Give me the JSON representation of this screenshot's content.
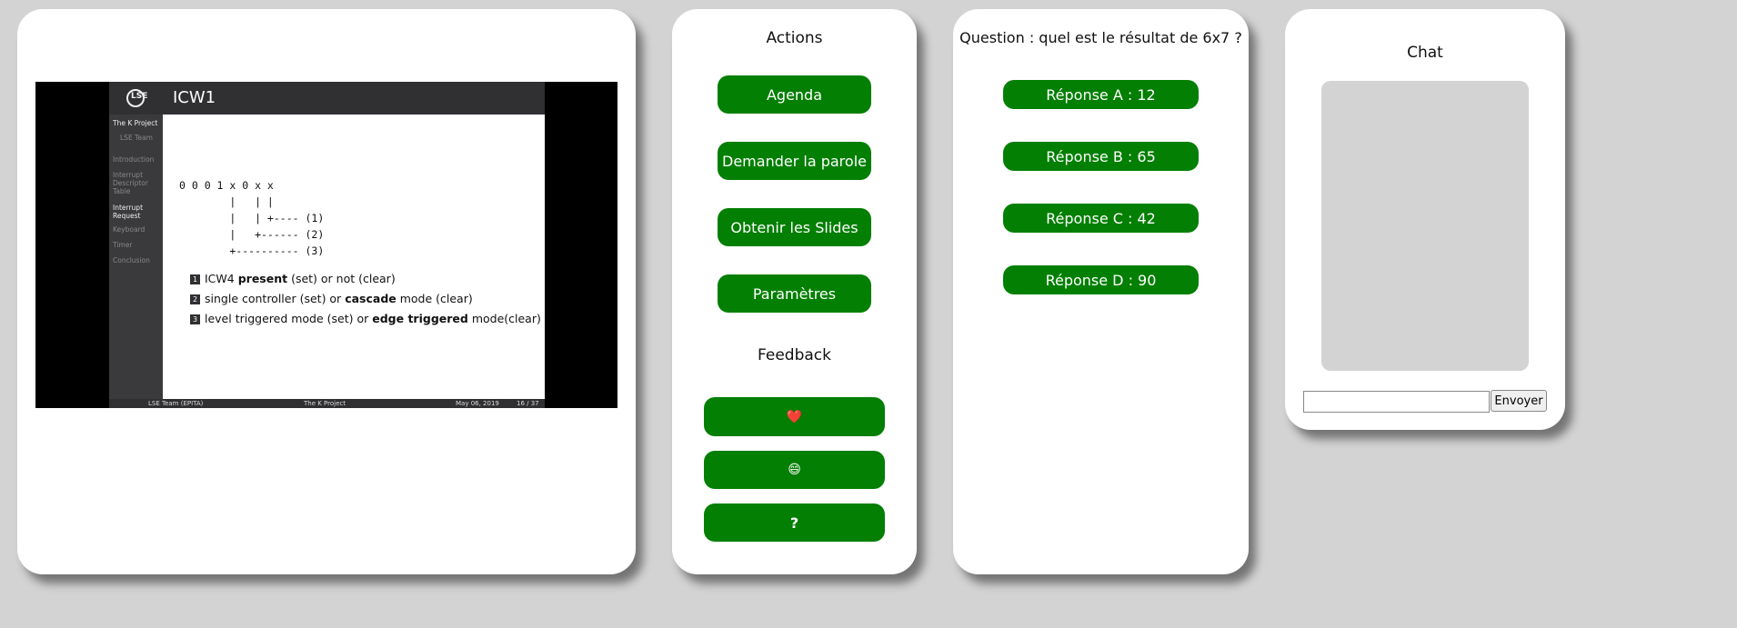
{
  "slide": {
    "logo": "LSE",
    "title": "ICW1",
    "sidebar": [
      "The K Project",
      "LSE Team",
      "Introduction",
      "Interrupt Descriptor Table",
      "Interrupt Request",
      "Keyboard",
      "Timer",
      "Conclusion"
    ],
    "code": "0 0 0 1 x 0 x x\n        |   | |\n        |   | +---- (1)\n        |   +------ (2)\n        +---------- (3)",
    "bullets": [
      {
        "num": "1",
        "pre": "ICW4 ",
        "bold": "present",
        "post": " (set) or not (clear)"
      },
      {
        "num": "2",
        "pre": "single controller (set) or ",
        "bold": "cascade",
        "post": " mode (clear)"
      },
      {
        "num": "3",
        "pre": "level triggered mode (set) or ",
        "bold": "edge triggered",
        "post": " mode(clear)"
      }
    ],
    "footer": {
      "left": "LSE Team  (EPITA)",
      "center": "The K Project",
      "date": "May 06, 2019",
      "page": "16 / 37"
    }
  },
  "actions": {
    "title": "Actions",
    "buttons": [
      "Agenda",
      "Demander la parole",
      "Obtenir les Slides",
      "Paramètres"
    ],
    "feedback_title": "Feedback",
    "feedback": [
      "❤️",
      "😄",
      "?"
    ]
  },
  "quiz": {
    "question": "Question : quel est le résultat de 6x7 ?",
    "answers": [
      "Réponse A : 12",
      "Réponse B : 65",
      "Réponse C : 42",
      "Réponse D : 90"
    ]
  },
  "chat": {
    "title": "Chat",
    "input_value": "",
    "send_label": "Envoyer"
  },
  "colors": {
    "background": "#d3d3d3",
    "button": "#037f03",
    "card": "#ffffff"
  }
}
